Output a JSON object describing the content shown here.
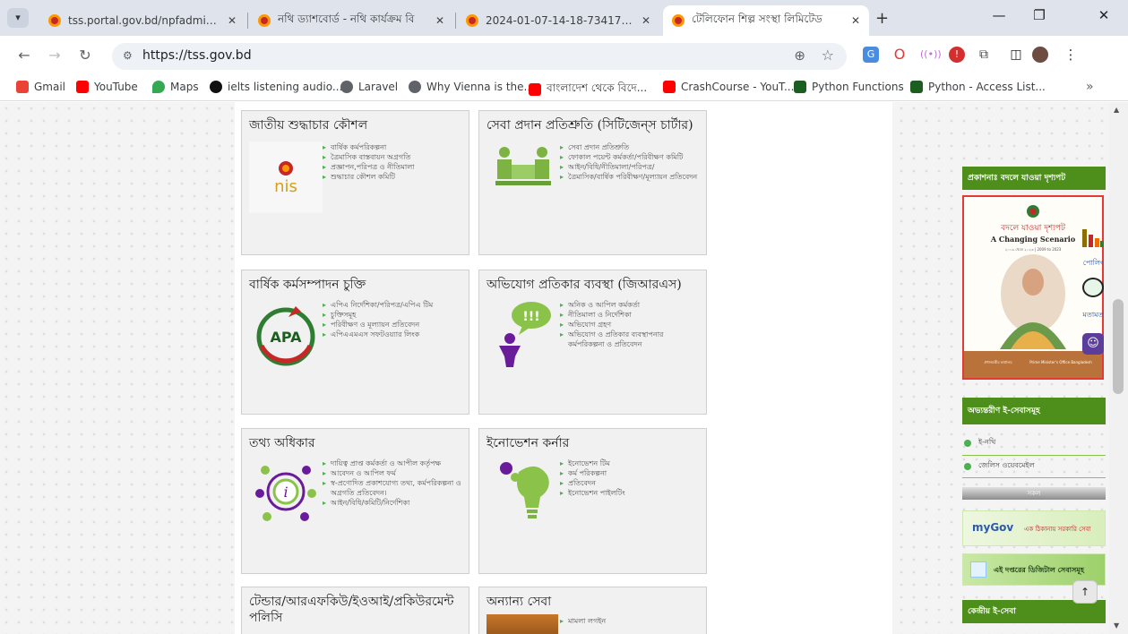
{
  "browser": {
    "tabs": [
      {
        "title": "tss.portal.gov.bd/npfadmin/pul",
        "active": false
      },
      {
        "title": "নথি ড্যাশবোর্ড - নথি কার্যক্রম বি",
        "active": false
      },
      {
        "title": "2024-01-07-14-18-7341790e62",
        "active": false
      },
      {
        "title": "টেলিফোন শিল্প সংস্থা লিমিটেড",
        "active": true
      }
    ],
    "new_tab": "+",
    "url": "https://tss.gov.bd",
    "bookmarks": [
      {
        "label": "Gmail",
        "color": "#ea4335"
      },
      {
        "label": "YouTube",
        "color": "#ff0000"
      },
      {
        "label": "Maps",
        "color": "#34a853"
      },
      {
        "label": "ielts listening audio...",
        "color": "#111111"
      },
      {
        "label": "Laravel",
        "color": "#5f6368"
      },
      {
        "label": "Why Vienna is the...",
        "color": "#5f6368"
      },
      {
        "label": "বাংলাদেশ থেকে বিদে...",
        "color": "#ff0000"
      },
      {
        "label": "CrashCourse - YouT...",
        "color": "#ff0000"
      },
      {
        "label": "Python Functions",
        "color": "#1b5e20"
      },
      {
        "label": "Python - Access List...",
        "color": "#1b5e20"
      }
    ],
    "more": "»"
  },
  "cards": [
    {
      "title": "জাতীয় শুদ্ধাচার কৌশল",
      "logo_text": "nis",
      "items": [
        "বার্ষিক কর্মপরিকল্পনা",
        "ত্রৈমাসিক বাস্তবায়ন অগ্রগতি",
        "প্রজ্ঞাপন,পরিপত্র ও নীতিমালা",
        "শুদ্ধাচার কৌশল কমিটি"
      ]
    },
    {
      "title": "সেবা প্রদান প্রতিশ্রুতি (সিটিজেন্‌স চার্টার)",
      "items": [
        "সেবা প্রদান প্রতিশ্রুতি",
        "ফোকাল পয়েন্ট কর্মকর্তা/পরিবীক্ষণ কমিটি",
        "আইন/বিধি/নীতিমালা/পরিপত্র/",
        "ত্রৈমাসিক/বার্ষিক পরিবীক্ষণ/মূল্যায়ন প্রতিবেদন"
      ]
    },
    {
      "title": "বার্ষিক কর্মসম্পাদন চুক্তি",
      "logo_text": "APA",
      "items": [
        "এপিএ নির্দেশিকা/পরিপত্র/এপিএ টিম",
        "চুক্তিসমূহ",
        "পরিবীক্ষণ ও মূল্যায়ন প্রতিবেদন",
        "এপিএএমএস সফটওয়্যার লিংক"
      ]
    },
    {
      "title": "অভিযোগ প্রতিকার ব্যবস্থা (জিআরএস)",
      "logo_text": "!!!",
      "items": [
        "অনিক ও আপিল কর্মকর্তা",
        "নীতিমালা ও নির্দেশিকা",
        "অভিযোগ গ্রহণ",
        "অভিযোগ ও প্রতিকার ব্যবস্থাপনার কর্মপরিকল্পনা ও প্রতিবেদন"
      ]
    },
    {
      "title": "তথ্য অধিকার",
      "logo_text": "i",
      "items": [
        "দায়িত্ব প্রাপ্ত কর্মকর্তা ও আপীল কর্তৃপক্ষ",
        "আবেদন ও আপিল ফর্ম",
        "স্ব-প্রণোদিত প্রকাশযোগ্য তথ্য, কর্মপরিকল্পনা ও অগ্রগতি প্রতিবেদন।",
        "আইন/বিধি/কমিটি/নির্দেশিকা"
      ]
    },
    {
      "title": "ইনোভেশন কর্নার",
      "items": [
        "ইনোভেশন টিম",
        "কর্ম পরিকল্পনা",
        "প্রতিবেদন",
        "ইনোভেশন পাইলটিং"
      ]
    },
    {
      "title": "টেন্ডার/আরএফকিউ/ইওআই/প্রকিউরমেন্ট পলিসি",
      "items": []
    },
    {
      "title": "অন্যান্য সেবা",
      "items": [
        "মামলা লগইন"
      ]
    }
  ],
  "sidebar": {
    "publication_heading": "প্রকাশনাঃ বদলে যাওয়া দৃশ্যপট",
    "poster": {
      "title_bn": "বদলে যাওয়া দৃশ্যপট",
      "title_en": "A Changing Scenario",
      "years": "২০০৯ থেকে ২০২৩ | 2009 to 2023",
      "footer_bn": "প্রধানমন্ত্রীর কার্যালয়",
      "footer_en": "Prime Minister's Office Bangladesh"
    },
    "internal_heading": "অভ্যন্তরীণ ই-সেবাসমূহ",
    "links": [
      "ই-নথি",
      "জেলিস ওয়েবমেইল"
    ],
    "graybar_label": "সকল",
    "mygov": {
      "brand": "myGov",
      "tagline": "এক ঠিকানায় সরকারি সেবা"
    },
    "digital_services": "এই দপ্তরের ডিজিটাল সেবাসমূহ",
    "central_heading": "কেন্দ্রীয় ই-সেবা"
  },
  "widgets": {
    "poll_label": "পোলিং",
    "feedback_label": "মতামত",
    "totop": "↑"
  }
}
